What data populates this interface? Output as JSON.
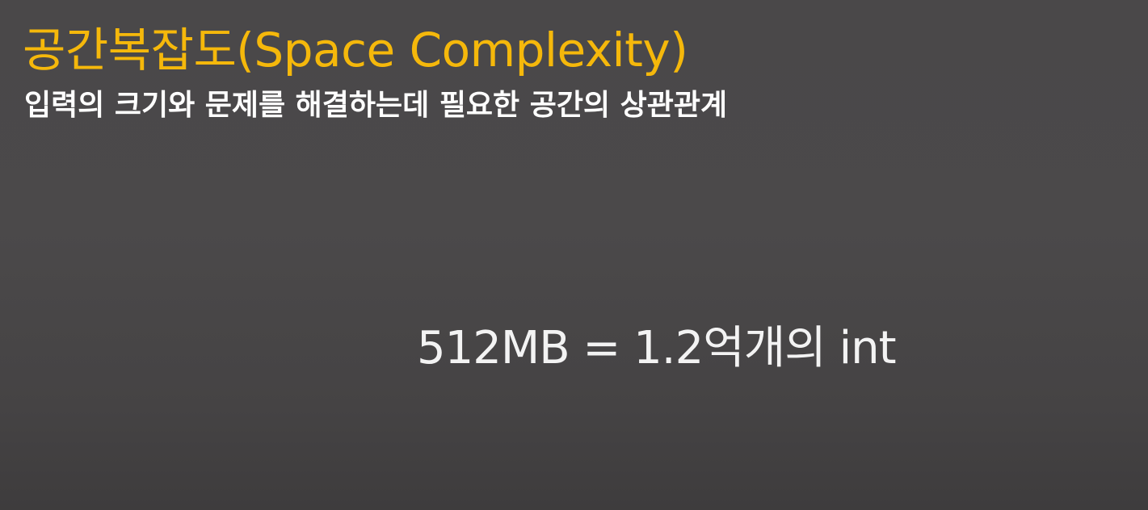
{
  "slide": {
    "title": "공간복잡도(Space Complexity)",
    "subtitle": "입력의 크기와 문제를 해결하는데 필요한 공간의 상관관계",
    "statement": "512MB = 1.2억개의 int"
  },
  "colors": {
    "background": "#4a4849",
    "title": "#f5b80b",
    "text": "#ffffff"
  }
}
